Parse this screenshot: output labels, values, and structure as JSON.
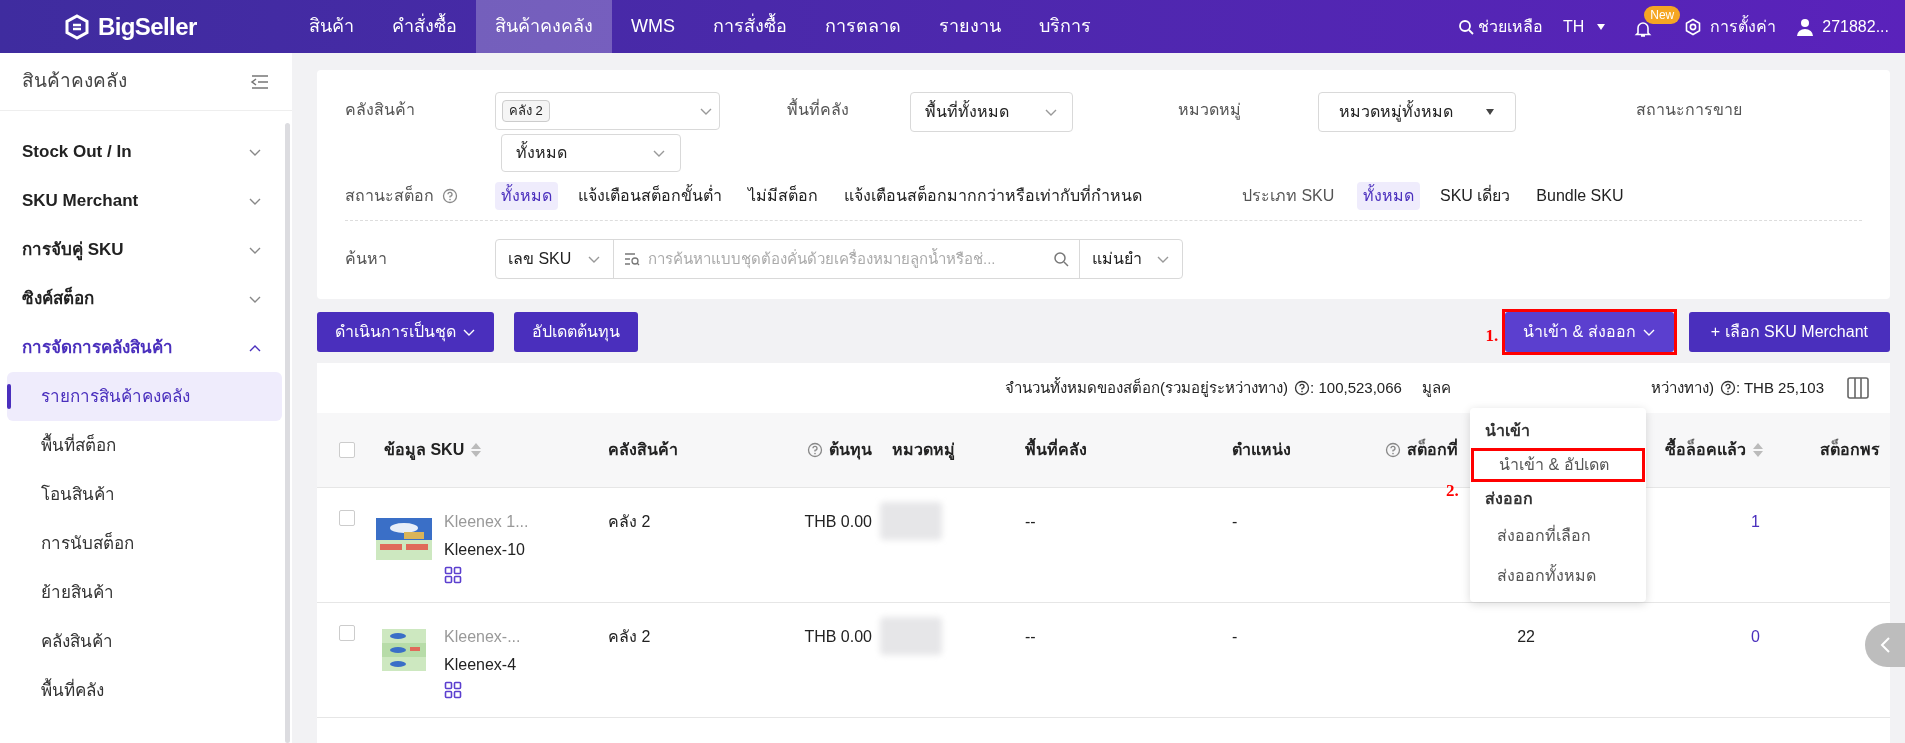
{
  "nav": {
    "logo": "BigSeller",
    "items": [
      {
        "label": "สินค้า",
        "selected": false
      },
      {
        "label": "คำสั่งซื้อ",
        "selected": false
      },
      {
        "label": "สินค้าคงคลัง",
        "selected": true
      },
      {
        "label": "WMS",
        "selected": false
      },
      {
        "label": "การสั่งซื้อ",
        "selected": false
      },
      {
        "label": "การตลาด",
        "selected": false
      },
      {
        "label": "รายงาน",
        "selected": false
      },
      {
        "label": "บริการ",
        "selected": false
      }
    ],
    "help": "ช่วยเหลือ",
    "language": "TH",
    "notification_badge": "New",
    "settings": "การตั้งค่า",
    "user": "271882..."
  },
  "sidebar": {
    "title": "สินค้าคงคลัง",
    "groups": [
      {
        "label": "Stock Out / In",
        "expanded": false
      },
      {
        "label": "SKU Merchant",
        "expanded": false
      },
      {
        "label": "การจับคู่ SKU",
        "expanded": false
      },
      {
        "label": "ซิงค์สต็อก",
        "expanded": false
      },
      {
        "label": "การจัดการคลังสินค้า",
        "expanded": true,
        "children": [
          {
            "label": "รายการสินค้าคงคลัง",
            "selected": true
          },
          {
            "label": "พื้นที่สต็อก",
            "selected": false
          },
          {
            "label": "โอนสินค้า",
            "selected": false
          },
          {
            "label": "การนับสต็อก",
            "selected": false
          },
          {
            "label": "ย้ายสินค้า",
            "selected": false
          },
          {
            "label": "คลังสินค้า",
            "selected": false
          },
          {
            "label": "พื้นที่คลัง",
            "selected": false
          }
        ]
      }
    ]
  },
  "filters": {
    "warehouse": {
      "label": "คลังสินค้า",
      "tag": "คลัง 2",
      "sub_value": "ทั้งหมด"
    },
    "area": {
      "label": "พื้นที่คลัง",
      "value": "พื้นที่ทั้งหมด"
    },
    "category": {
      "label": "หมวดหมู่",
      "value": "หมวดหมู่ทั้งหมด"
    },
    "sale_status": {
      "label": "สถานะการขาย"
    },
    "stock_status": {
      "label": "สถานะสต็อก",
      "options": [
        {
          "label": "ทั้งหมด",
          "selected": true
        },
        {
          "label": "แจ้งเตือนสต็อกขั้นต่ำ",
          "selected": false
        },
        {
          "label": "ไม่มีสต็อก",
          "selected": false
        },
        {
          "label": "แจ้งเตือนสต็อกมากกว่าหรือเท่ากับที่กำหนด",
          "selected": false
        }
      ]
    },
    "sku_type": {
      "label": "ประเภท SKU",
      "options": [
        {
          "label": "ทั้งหมด",
          "selected": true
        },
        {
          "label": "SKU เดี่ยว",
          "selected": false
        },
        {
          "label": "Bundle SKU",
          "selected": false
        }
      ]
    },
    "search": {
      "label": "ค้นหา",
      "field": "เลข SKU",
      "placeholder": "การค้นหาแบบชุดต้องคั่นด้วยเครื่องหมายลูกน้ำหรือช่...",
      "mode": "แม่นยำ"
    }
  },
  "toolbar": {
    "left": [
      {
        "label": "ดำเนินการเป็นชุด",
        "dropdown": true
      },
      {
        "label": "อัปเดตต้นทุน",
        "dropdown": false
      }
    ],
    "right": [
      {
        "label": "นำเข้า & ส่งออก",
        "dropdown": true,
        "annotation": "1."
      },
      {
        "label": "+ เลือก SKU Merchant",
        "dropdown": false
      }
    ]
  },
  "menu": {
    "sections": [
      {
        "heading": "นำเข้า",
        "items": [
          {
            "label": "นำเข้า & อัปเดต",
            "annotation": "2."
          }
        ]
      },
      {
        "heading": "ส่งออก",
        "items": [
          {
            "label": "ส่งออกที่เลือก"
          },
          {
            "label": "ส่งออกทั้งหมด"
          }
        ]
      }
    ]
  },
  "stats": {
    "total_label": "จำนวนทั้งหมดของสต็อก(รวมอยู่ระหว่างทาง)",
    "total_value": ": 100,523,066",
    "value_label_start": "มูลค",
    "value_label_end": "หว่างทาง)",
    "value_value": ": THB 25,103"
  },
  "table": {
    "header_checked": false,
    "columns": [
      {
        "label": "ข้อมูล SKU",
        "kind": "sortable"
      },
      {
        "label": "คลังสินค้า",
        "kind": "plain"
      },
      {
        "label": "ต้นทุน",
        "kind": "help"
      },
      {
        "label": "หมวดหมู่",
        "kind": "plain"
      },
      {
        "label": "พื้นที่คลัง",
        "kind": "plain"
      },
      {
        "label": "ตำแหน่ง",
        "kind": "plain"
      },
      {
        "label": "สต็อกที่",
        "kind": "help"
      },
      {
        "label": "ซื้อล็อคแล้ว",
        "kind": "sortable"
      },
      {
        "label": "สต็อกพร",
        "kind": "plain"
      }
    ],
    "rows": [
      {
        "title": "Kleenex 1...",
        "sku": "Kleenex-10",
        "warehouse": "คลัง 2",
        "cost": "THB 0.00",
        "area": "--",
        "location": "-",
        "locked": "1",
        "checked": false
      },
      {
        "title": "Kleenex-...",
        "sku": "Kleenex-4",
        "warehouse": "คลัง 2",
        "cost": "THB 0.00",
        "area": "--",
        "location": "-",
        "stock": "22",
        "locked": "0",
        "checked": false
      }
    ]
  }
}
